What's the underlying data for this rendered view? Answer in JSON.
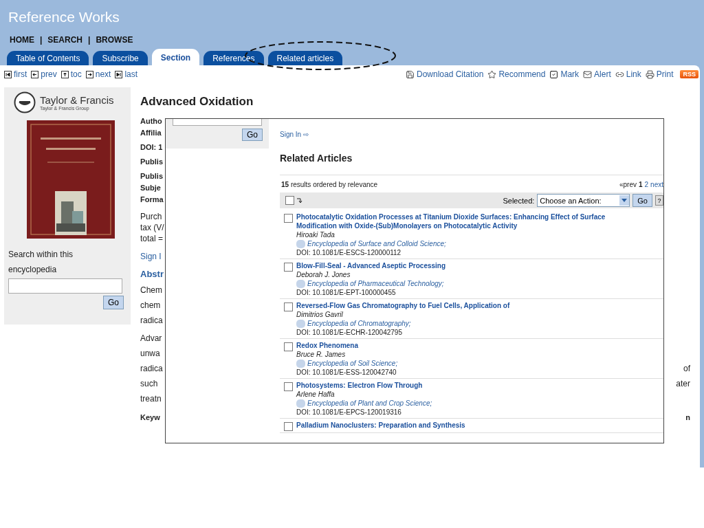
{
  "site": {
    "title": "Reference Works"
  },
  "nav": {
    "separator": "|",
    "items": [
      "HOME",
      "SEARCH",
      "BROWSE"
    ]
  },
  "tabs": [
    {
      "label": "Table of Contents",
      "selected": false
    },
    {
      "label": "Subscribe",
      "selected": false
    },
    {
      "label": "Section",
      "selected": true
    },
    {
      "label": "References",
      "selected": false
    },
    {
      "label": "Related articles",
      "selected": false
    }
  ],
  "pager_links": [
    {
      "label": "first",
      "kind": "first"
    },
    {
      "label": "prev",
      "kind": "prev"
    },
    {
      "label": "toc",
      "kind": "toc"
    },
    {
      "label": "next",
      "kind": "next"
    },
    {
      "label": "last",
      "kind": "last"
    }
  ],
  "tools": [
    {
      "label": "Download Citation",
      "kind": "download"
    },
    {
      "label": "Recommend",
      "kind": "recommend"
    },
    {
      "label": "Mark",
      "kind": "mark"
    },
    {
      "label": "Alert",
      "kind": "alert"
    },
    {
      "label": "Link",
      "kind": "link"
    },
    {
      "label": "Print",
      "kind": "print"
    }
  ],
  "rss_badge": "RSS",
  "sidebar": {
    "publisher": "Taylor & Francis",
    "publisher_group": "Taylor & Francis Group",
    "search_label": "Search within this encyclopedia",
    "search_button": "Go"
  },
  "article": {
    "title": "Advanced Oxidation",
    "groups": [
      {
        "kind": "label",
        "lines": [
          {
            "left": "Autho"
          },
          {
            "left": "Affilia"
          }
        ]
      },
      {
        "kind": "label",
        "lines": [
          {
            "left": "DOI: 1"
          }
        ]
      },
      {
        "kind": "label",
        "lines": [
          {
            "left": "Publis"
          }
        ]
      },
      {
        "kind": "label",
        "lines": [
          {
            "left": "Publis"
          },
          {
            "left": "Subje"
          },
          {
            "left": "Forma"
          }
        ]
      },
      {
        "kind": "text",
        "lines": [
          {
            "left": "Purch"
          },
          {
            "left": "tax (V/"
          },
          {
            "left": "total ="
          }
        ]
      },
      {
        "kind": "link",
        "lines": [
          {
            "left": "Sign I"
          }
        ]
      },
      {
        "kind": "heading",
        "lines": [
          {
            "left": "Abstr"
          }
        ]
      },
      {
        "kind": "paragraph",
        "lines": [
          {
            "left": "Chem"
          },
          {
            "left": "chem"
          },
          {
            "left": "radica"
          }
        ]
      },
      {
        "kind": "paragraph",
        "lines": [
          {
            "left": "Advar"
          },
          {
            "left": "unwa"
          },
          {
            "left": "radica",
            "right": "of"
          },
          {
            "left": "such",
            "right": "ater"
          },
          {
            "left": "treatn"
          }
        ]
      },
      {
        "kind": "keyword",
        "lines": [
          {
            "left": "Keyw",
            "right": "n"
          }
        ]
      }
    ]
  },
  "popup": {
    "search_button": "Go",
    "sign_in": "Sign In ⇨",
    "heading": "Related Articles",
    "count": "15",
    "count_text": "results ordered by relevance",
    "pager": {
      "prev": "«prev",
      "current": "1",
      "other": "2",
      "next": "next"
    },
    "select_all_checked": false,
    "selected_label": "Selected:",
    "action_select": "Choose an Action:",
    "go_button": "Go",
    "help_button": "?",
    "results": [
      {
        "title": "Photocatalytic Oxidation Processes at Titanium Dioxide Surfaces: Enhancing Effect of Surface Modification with Oxide-(Sub)Monolayers on Photocatalytic Activity",
        "author": "Hiroaki Tada",
        "journal": "Encyclopedia of Surface and Colloid Science;",
        "doi": "DOI: 10.1081/E-ESCS-120000112",
        "checked": false
      },
      {
        "title": "Blow-Fill-Seal - Advanced Aseptic Processing",
        "author": "Deborah J. Jones",
        "journal": "Encyclopedia of Pharmaceutical Technology;",
        "doi": "DOI: 10.1081/E-EPT-100000455",
        "checked": false
      },
      {
        "title": "Reversed-Flow Gas Chromatography to Fuel Cells, Application of",
        "author": "Dimitrios Gavril",
        "journal": "Encyclopedia of Chromatography;",
        "doi": "DOI: 10.1081/E-ECHR-120042795",
        "checked": false
      },
      {
        "title": "Redox Phenomena",
        "author": "Bruce R. James",
        "journal": "Encyclopedia of Soil Science;",
        "doi": "DOI: 10.1081/E-ESS-120042740",
        "checked": false
      },
      {
        "title": "Photosystems: Electron Flow Through",
        "author": "Arlene Haffa",
        "journal": "Encyclopedia of Plant and Crop Science;",
        "doi": "DOI: 10.1081/E-EPCS-120019316",
        "checked": false
      },
      {
        "title": "Palladium Nanoclusters: Preparation and Synthesis",
        "checked": false
      }
    ]
  }
}
